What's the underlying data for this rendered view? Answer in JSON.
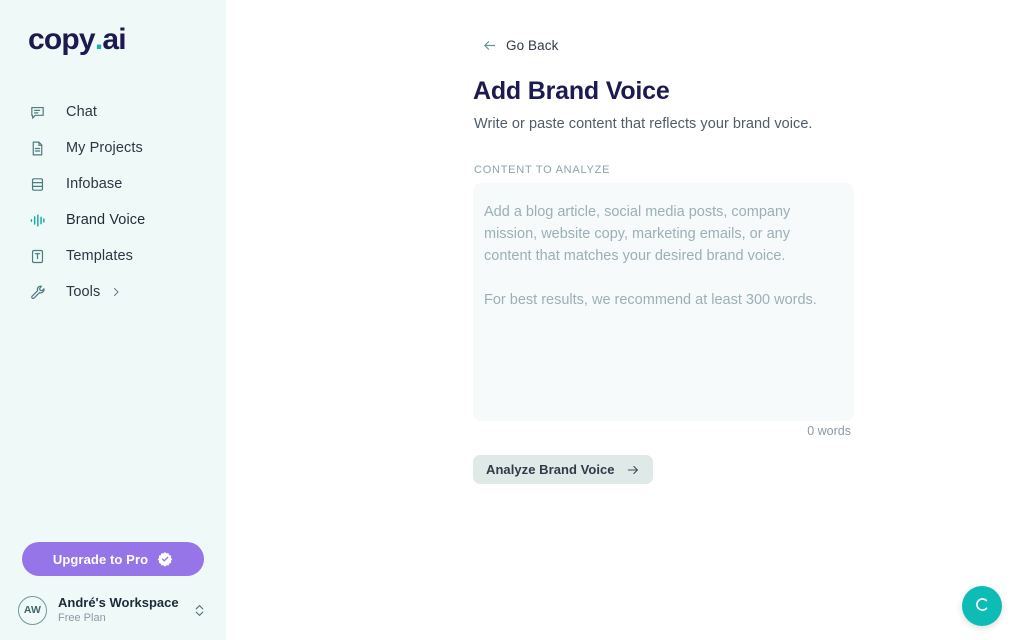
{
  "sidebar": {
    "logo": {
      "name": "copy",
      "dot": ".",
      "suffix": "ai"
    },
    "items": [
      {
        "label": "Chat",
        "icon": "chat-bubble-icon",
        "active": false
      },
      {
        "label": "My Projects",
        "icon": "document-icon",
        "active": false
      },
      {
        "label": "Infobase",
        "icon": "database-icon",
        "active": false
      },
      {
        "label": "Brand Voice",
        "icon": "audio-bars-icon",
        "active": true
      },
      {
        "label": "Templates",
        "icon": "template-icon",
        "active": false
      },
      {
        "label": "Tools",
        "icon": "wrench-icon",
        "active": false,
        "chevron": true
      }
    ],
    "upgrade": {
      "label": "Upgrade to Pro",
      "icon": "verified-badge-icon"
    },
    "workspace": {
      "initials": "AW",
      "name": "André's Workspace",
      "plan": "Free Plan",
      "caret_icon": "chevron-up-down-icon"
    }
  },
  "main": {
    "back": {
      "label": "Go Back",
      "icon": "arrow-left-icon"
    },
    "title": "Add Brand Voice",
    "subtitle": "Write or paste content that reflects your brand voice.",
    "field_label": "CONTENT TO ANALYZE",
    "editor": {
      "value": "",
      "placeholder": "Add a blog article, social media posts, company mission, website copy, marketing emails, or any content that matches your desired brand voice.\n\nFor best results, we recommend at least 300 words."
    },
    "word_count": "0 words",
    "analyze": {
      "label": "Analyze Brand Voice",
      "icon": "arrow-right-icon"
    }
  },
  "fab": {
    "icon": "copyai-c-icon",
    "label": "C"
  },
  "colors": {
    "sidebar_bg": "#effaf8",
    "main_bg": "#ffffff",
    "brand_navy": "#1c1a4e",
    "brand_teal": "#12b5ad",
    "accent_purple": "#9575e8",
    "fab_teal": "#0dbcb4",
    "button_bg": "#dfe9e7",
    "editor_bg": "#f7fafb"
  }
}
